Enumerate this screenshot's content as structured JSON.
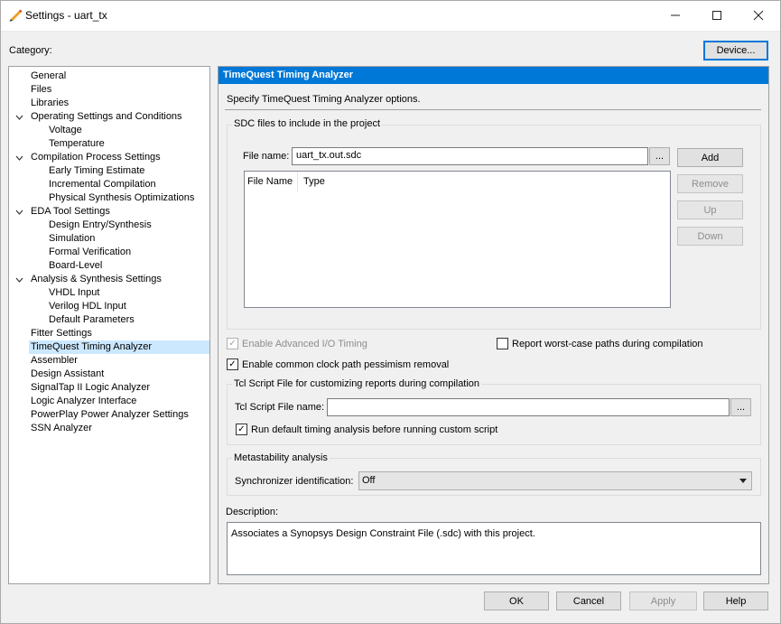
{
  "window": {
    "title": "Settings - uart_tx"
  },
  "category_label": "Category:",
  "device_button": "Device...",
  "tree": [
    {
      "label": "General",
      "level": 0,
      "expander": false
    },
    {
      "label": "Files",
      "level": 0,
      "expander": false
    },
    {
      "label": "Libraries",
      "level": 0,
      "expander": false
    },
    {
      "label": "Operating Settings and Conditions",
      "level": 0,
      "expander": true
    },
    {
      "label": "Voltage",
      "level": 1,
      "expander": false
    },
    {
      "label": "Temperature",
      "level": 1,
      "expander": false
    },
    {
      "label": "Compilation Process Settings",
      "level": 0,
      "expander": true
    },
    {
      "label": "Early Timing Estimate",
      "level": 1,
      "expander": false
    },
    {
      "label": "Incremental Compilation",
      "level": 1,
      "expander": false
    },
    {
      "label": "Physical Synthesis Optimizations",
      "level": 1,
      "expander": false
    },
    {
      "label": "EDA Tool Settings",
      "level": 0,
      "expander": true
    },
    {
      "label": "Design Entry/Synthesis",
      "level": 1,
      "expander": false
    },
    {
      "label": "Simulation",
      "level": 1,
      "expander": false
    },
    {
      "label": "Formal Verification",
      "level": 1,
      "expander": false
    },
    {
      "label": "Board-Level",
      "level": 1,
      "expander": false
    },
    {
      "label": "Analysis & Synthesis Settings",
      "level": 0,
      "expander": true
    },
    {
      "label": "VHDL Input",
      "level": 1,
      "expander": false
    },
    {
      "label": "Verilog HDL Input",
      "level": 1,
      "expander": false
    },
    {
      "label": "Default Parameters",
      "level": 1,
      "expander": false
    },
    {
      "label": "Fitter Settings",
      "level": 0,
      "expander": false
    },
    {
      "label": "TimeQuest Timing Analyzer",
      "level": 0,
      "expander": false,
      "selected": true
    },
    {
      "label": "Assembler",
      "level": 0,
      "expander": false
    },
    {
      "label": "Design Assistant",
      "level": 0,
      "expander": false
    },
    {
      "label": "SignalTap II Logic Analyzer",
      "level": 0,
      "expander": false
    },
    {
      "label": "Logic Analyzer Interface",
      "level": 0,
      "expander": false
    },
    {
      "label": "PowerPlay Power Analyzer Settings",
      "level": 0,
      "expander": false
    },
    {
      "label": "SSN Analyzer",
      "level": 0,
      "expander": false
    }
  ],
  "panel": {
    "header": "TimeQuest Timing Analyzer",
    "intro": "Specify TimeQuest Timing Analyzer options.",
    "sdc_group": "SDC files to include in the project",
    "file_name_label": "File name:",
    "file_name_value": "uart_tx.out.sdc",
    "browse": "...",
    "columns": [
      "File Name",
      "Type"
    ],
    "add": "Add",
    "remove": "Remove",
    "up": "Up",
    "down": "Down",
    "enable_adv_io": "Enable Advanced I/O Timing",
    "report_worst": "Report worst-case paths during compilation",
    "enable_ccpp": "Enable common clock path pessimism removal",
    "tcl_group": "Tcl Script File for customizing reports during compilation",
    "tcl_label": "Tcl Script File name:",
    "tcl_value": "",
    "run_default": "Run default timing analysis before running custom script",
    "meta_group": "Metastability analysis",
    "sync_label": "Synchronizer identification:",
    "sync_value": "Off",
    "description_label": "Description:",
    "description": "Associates a Synopsys Design Constraint File (.sdc) with this project."
  },
  "checks": {
    "enable_adv_io": true,
    "report_worst": false,
    "enable_ccpp": true,
    "run_default": true
  },
  "footer": {
    "ok": "OK",
    "cancel": "Cancel",
    "apply": "Apply",
    "help": "Help"
  },
  "colors": {
    "accent": "#0078d7",
    "selection": "#cce8ff"
  }
}
